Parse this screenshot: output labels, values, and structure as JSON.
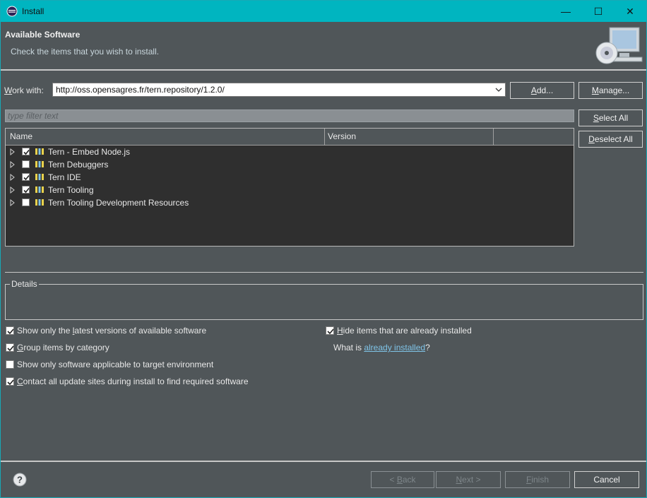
{
  "window": {
    "title": "Install",
    "controls": {
      "minimize": "—",
      "maximize": "☐",
      "close": "✕"
    }
  },
  "header": {
    "title": "Available Software",
    "description": "Check the items that you wish to install."
  },
  "work_with": {
    "label_prefix": "W",
    "label_rest": "ork with:",
    "value": "http://oss.opensagres.fr/tern.repository/1.2.0/",
    "add_label_prefix": "A",
    "add_label_rest": "dd...",
    "manage_label_prefix": "M",
    "manage_label_rest": "anage..."
  },
  "filter": {
    "placeholder": "type filter text"
  },
  "select_buttons": {
    "select_all_prefix": "S",
    "select_all_rest": "elect All",
    "deselect_all_prefix": "D",
    "deselect_all_rest": "eselect All"
  },
  "tree": {
    "columns": [
      "Name",
      "Version"
    ],
    "items": [
      {
        "name": "Tern - Embed Node.js",
        "checked": true
      },
      {
        "name": "Tern Debuggers",
        "checked": false
      },
      {
        "name": "Tern IDE",
        "checked": true
      },
      {
        "name": "Tern Tooling",
        "checked": true
      },
      {
        "name": "Tern Tooling Development Resources",
        "checked": false
      }
    ]
  },
  "details": {
    "legend": "Details"
  },
  "options": {
    "latest": {
      "pre": "Show only the ",
      "u": "l",
      "post": "atest versions of available software",
      "checked": true
    },
    "group": {
      "pre": "",
      "u": "G",
      "post": "roup items by category",
      "checked": true
    },
    "applicable": {
      "pre": "Show only software applicable to target environment",
      "u": "",
      "post": "",
      "checked": false
    },
    "contact": {
      "pre": "",
      "u": "C",
      "post": "ontact all update sites during install to find required software",
      "checked": true
    },
    "hide": {
      "pre": "",
      "u": "H",
      "post": "ide items that are already installed",
      "checked": true
    },
    "what_is_prefix": "What is ",
    "what_is_link": "already installed",
    "what_is_suffix": "?"
  },
  "footer": {
    "back_pre": "< ",
    "back_u": "B",
    "back_post": "ack",
    "next_u": "N",
    "next_post": "ext >",
    "finish_u": "F",
    "finish_post": "inish",
    "cancel": "Cancel"
  },
  "colors": {
    "titlebar": "#00b5c0",
    "background": "#505659",
    "tree_background": "#2f2f2f",
    "link": "#7fc4e8"
  }
}
